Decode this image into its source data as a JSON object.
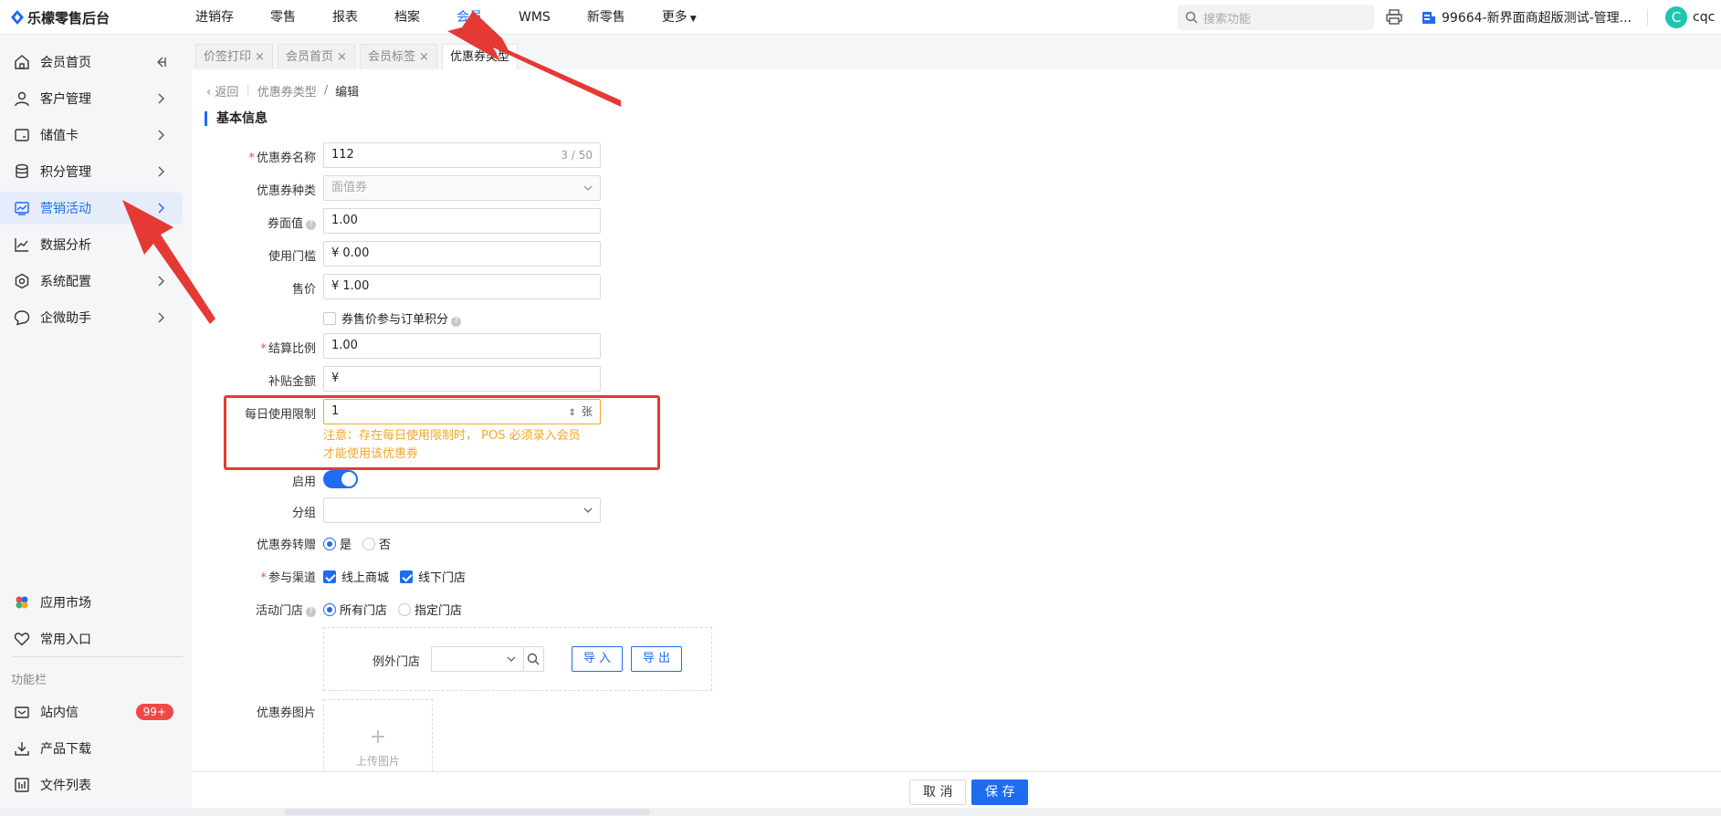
{
  "app": {
    "title": "乐檬零售后台"
  },
  "topnav": {
    "items": [
      "进销存",
      "零售",
      "报表",
      "档案",
      "会员",
      "WMS",
      "新零售",
      "更多"
    ]
  },
  "search": {
    "placeholder": "搜索功能"
  },
  "store": {
    "name": "99664-新界面商超版测试-管理..."
  },
  "user": {
    "initial": "C",
    "name": "cqc"
  },
  "sidebar": {
    "items": [
      "会员首页",
      "客户管理",
      "储值卡",
      "积分管理",
      "营销活动",
      "数据分析",
      "系统配置",
      "企微助手"
    ],
    "bottom": [
      "应用市场",
      "常用入口"
    ],
    "section_label": "功能栏",
    "tools": [
      "站内信",
      "产品下载",
      "文件列表"
    ],
    "badge": "99+"
  },
  "tabs": [
    "价签打印",
    "会员首页",
    "会员标签",
    "优惠券类型"
  ],
  "breadcrumb": {
    "back": "返回",
    "parent": "优惠券类型",
    "sep": "/",
    "current": "编辑"
  },
  "section": {
    "title": "基本信息"
  },
  "form": {
    "name_label": "优惠券名称",
    "name_value": "112",
    "name_count": "3 / 50",
    "type_label": "优惠券种类",
    "type_value": "面值券",
    "face_label": "券面值",
    "face_value": "1.00",
    "threshold_label": "使用门槛",
    "threshold_value": "¥ 0.00",
    "price_label": "售价",
    "price_value": "¥ 1.00",
    "points_label": "券售价参与订单积分",
    "ratio_label": "结算比例",
    "ratio_value": "1.00",
    "subsidy_label": "补贴金额",
    "subsidy_value": "¥",
    "daily_label": "每日使用限制",
    "daily_value": "1",
    "daily_unit": "张",
    "note_line1": "注意：存在每日使用限制时， POS 必须录入会员",
    "note_line2": "才能使用该优惠券",
    "enable_label": "启用",
    "group_label": "分组",
    "transfer_label": "优惠券转赠",
    "transfer_yes": "是",
    "transfer_no": "否",
    "channel_label": "参与渠道",
    "channel_online": "线上商城",
    "channel_offline": "线下门店",
    "stores_label": "活动门店",
    "stores_all": "所有门店",
    "stores_specific": "指定门店",
    "except_label": "例外门店",
    "import": "导 入",
    "export": "导 出",
    "image_label": "优惠券图片",
    "upload": "上传图片"
  },
  "footer": {
    "cancel": "取 消",
    "save": "保 存"
  },
  "colors": {
    "accent": "#1e6cf0",
    "warning": "#f5a623",
    "annotation": "#e53935"
  }
}
